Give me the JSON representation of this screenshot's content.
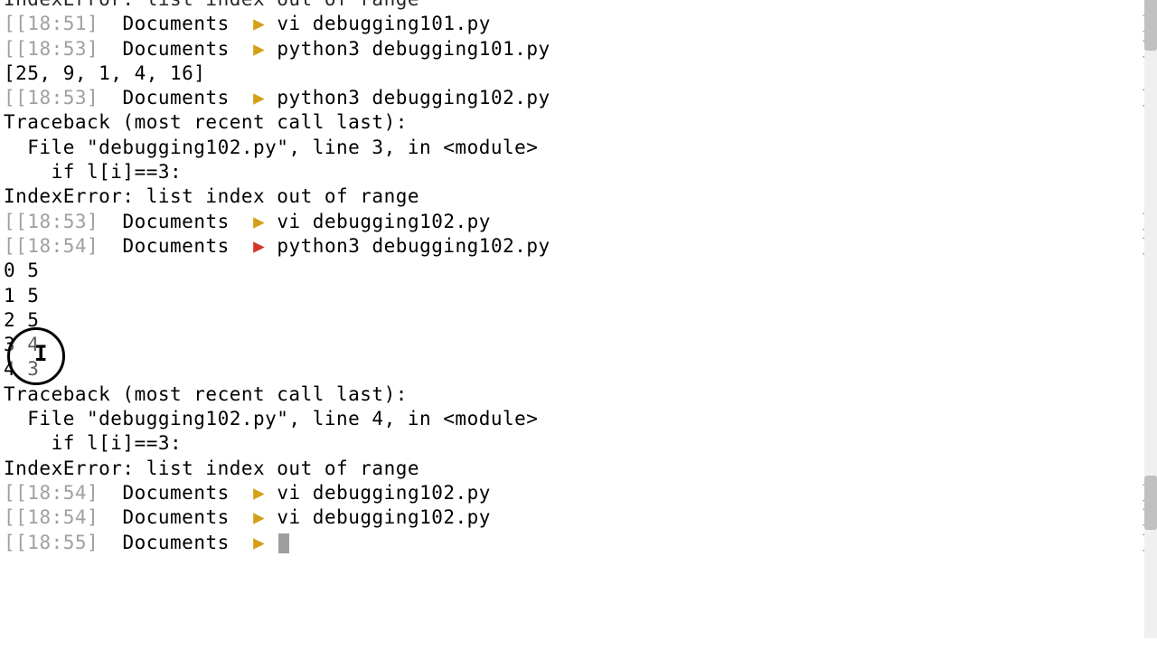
{
  "lines": [
    {
      "type": "output",
      "text": "IndexError: list index out of range",
      "cut": true
    },
    {
      "type": "prompt",
      "time": "[18:51]",
      "dir": "Documents",
      "arrow": "yellow",
      "cmd": "vi debugging101.py",
      "rb": true
    },
    {
      "type": "prompt",
      "time": "[18:53]",
      "dir": "Documents",
      "arrow": "yellow",
      "cmd": "python3 debugging101.py",
      "rb": true
    },
    {
      "type": "output",
      "text": "[25, 9, 1, 4, 16]"
    },
    {
      "type": "prompt",
      "time": "[18:53]",
      "dir": "Documents",
      "arrow": "yellow",
      "cmd": "python3 debugging102.py",
      "rb": true
    },
    {
      "type": "output",
      "text": "Traceback (most recent call last):"
    },
    {
      "type": "output",
      "text": "  File \"debugging102.py\", line 3, in <module>"
    },
    {
      "type": "output",
      "text": "    if l[i]==3:"
    },
    {
      "type": "output",
      "text": "IndexError: list index out of range"
    },
    {
      "type": "prompt",
      "time": "[18:53]",
      "dir": "Documents",
      "arrow": "yellow",
      "cmd": "vi debugging102.py",
      "rb": true
    },
    {
      "type": "prompt",
      "time": "[18:54]",
      "dir": "Documents",
      "arrow": "red",
      "cmd": "python3 debugging102.py",
      "rb": true
    },
    {
      "type": "output",
      "text": "0 5"
    },
    {
      "type": "output",
      "text": "1 5"
    },
    {
      "type": "output",
      "text": "2 5"
    },
    {
      "type": "output",
      "text": "3 4"
    },
    {
      "type": "output",
      "text": "4 3"
    },
    {
      "type": "output",
      "text": "Traceback (most recent call last):"
    },
    {
      "type": "output",
      "text": "  File \"debugging102.py\", line 4, in <module>"
    },
    {
      "type": "output",
      "text": "    if l[i]==3:"
    },
    {
      "type": "output",
      "text": "IndexError: list index out of range"
    },
    {
      "type": "prompt",
      "time": "[18:54]",
      "dir": "Documents",
      "arrow": "yellow",
      "cmd": "vi debugging102.py",
      "rb": true
    },
    {
      "type": "prompt",
      "time": "[18:54]",
      "dir": "Documents",
      "arrow": "yellow",
      "cmd": "vi debugging102.py",
      "rb": true
    },
    {
      "type": "prompt",
      "time": "[18:55]",
      "dir": "Documents",
      "arrow": "yellow",
      "cmd": "",
      "rb": true,
      "cursor": true
    }
  ],
  "triangle": "▶"
}
